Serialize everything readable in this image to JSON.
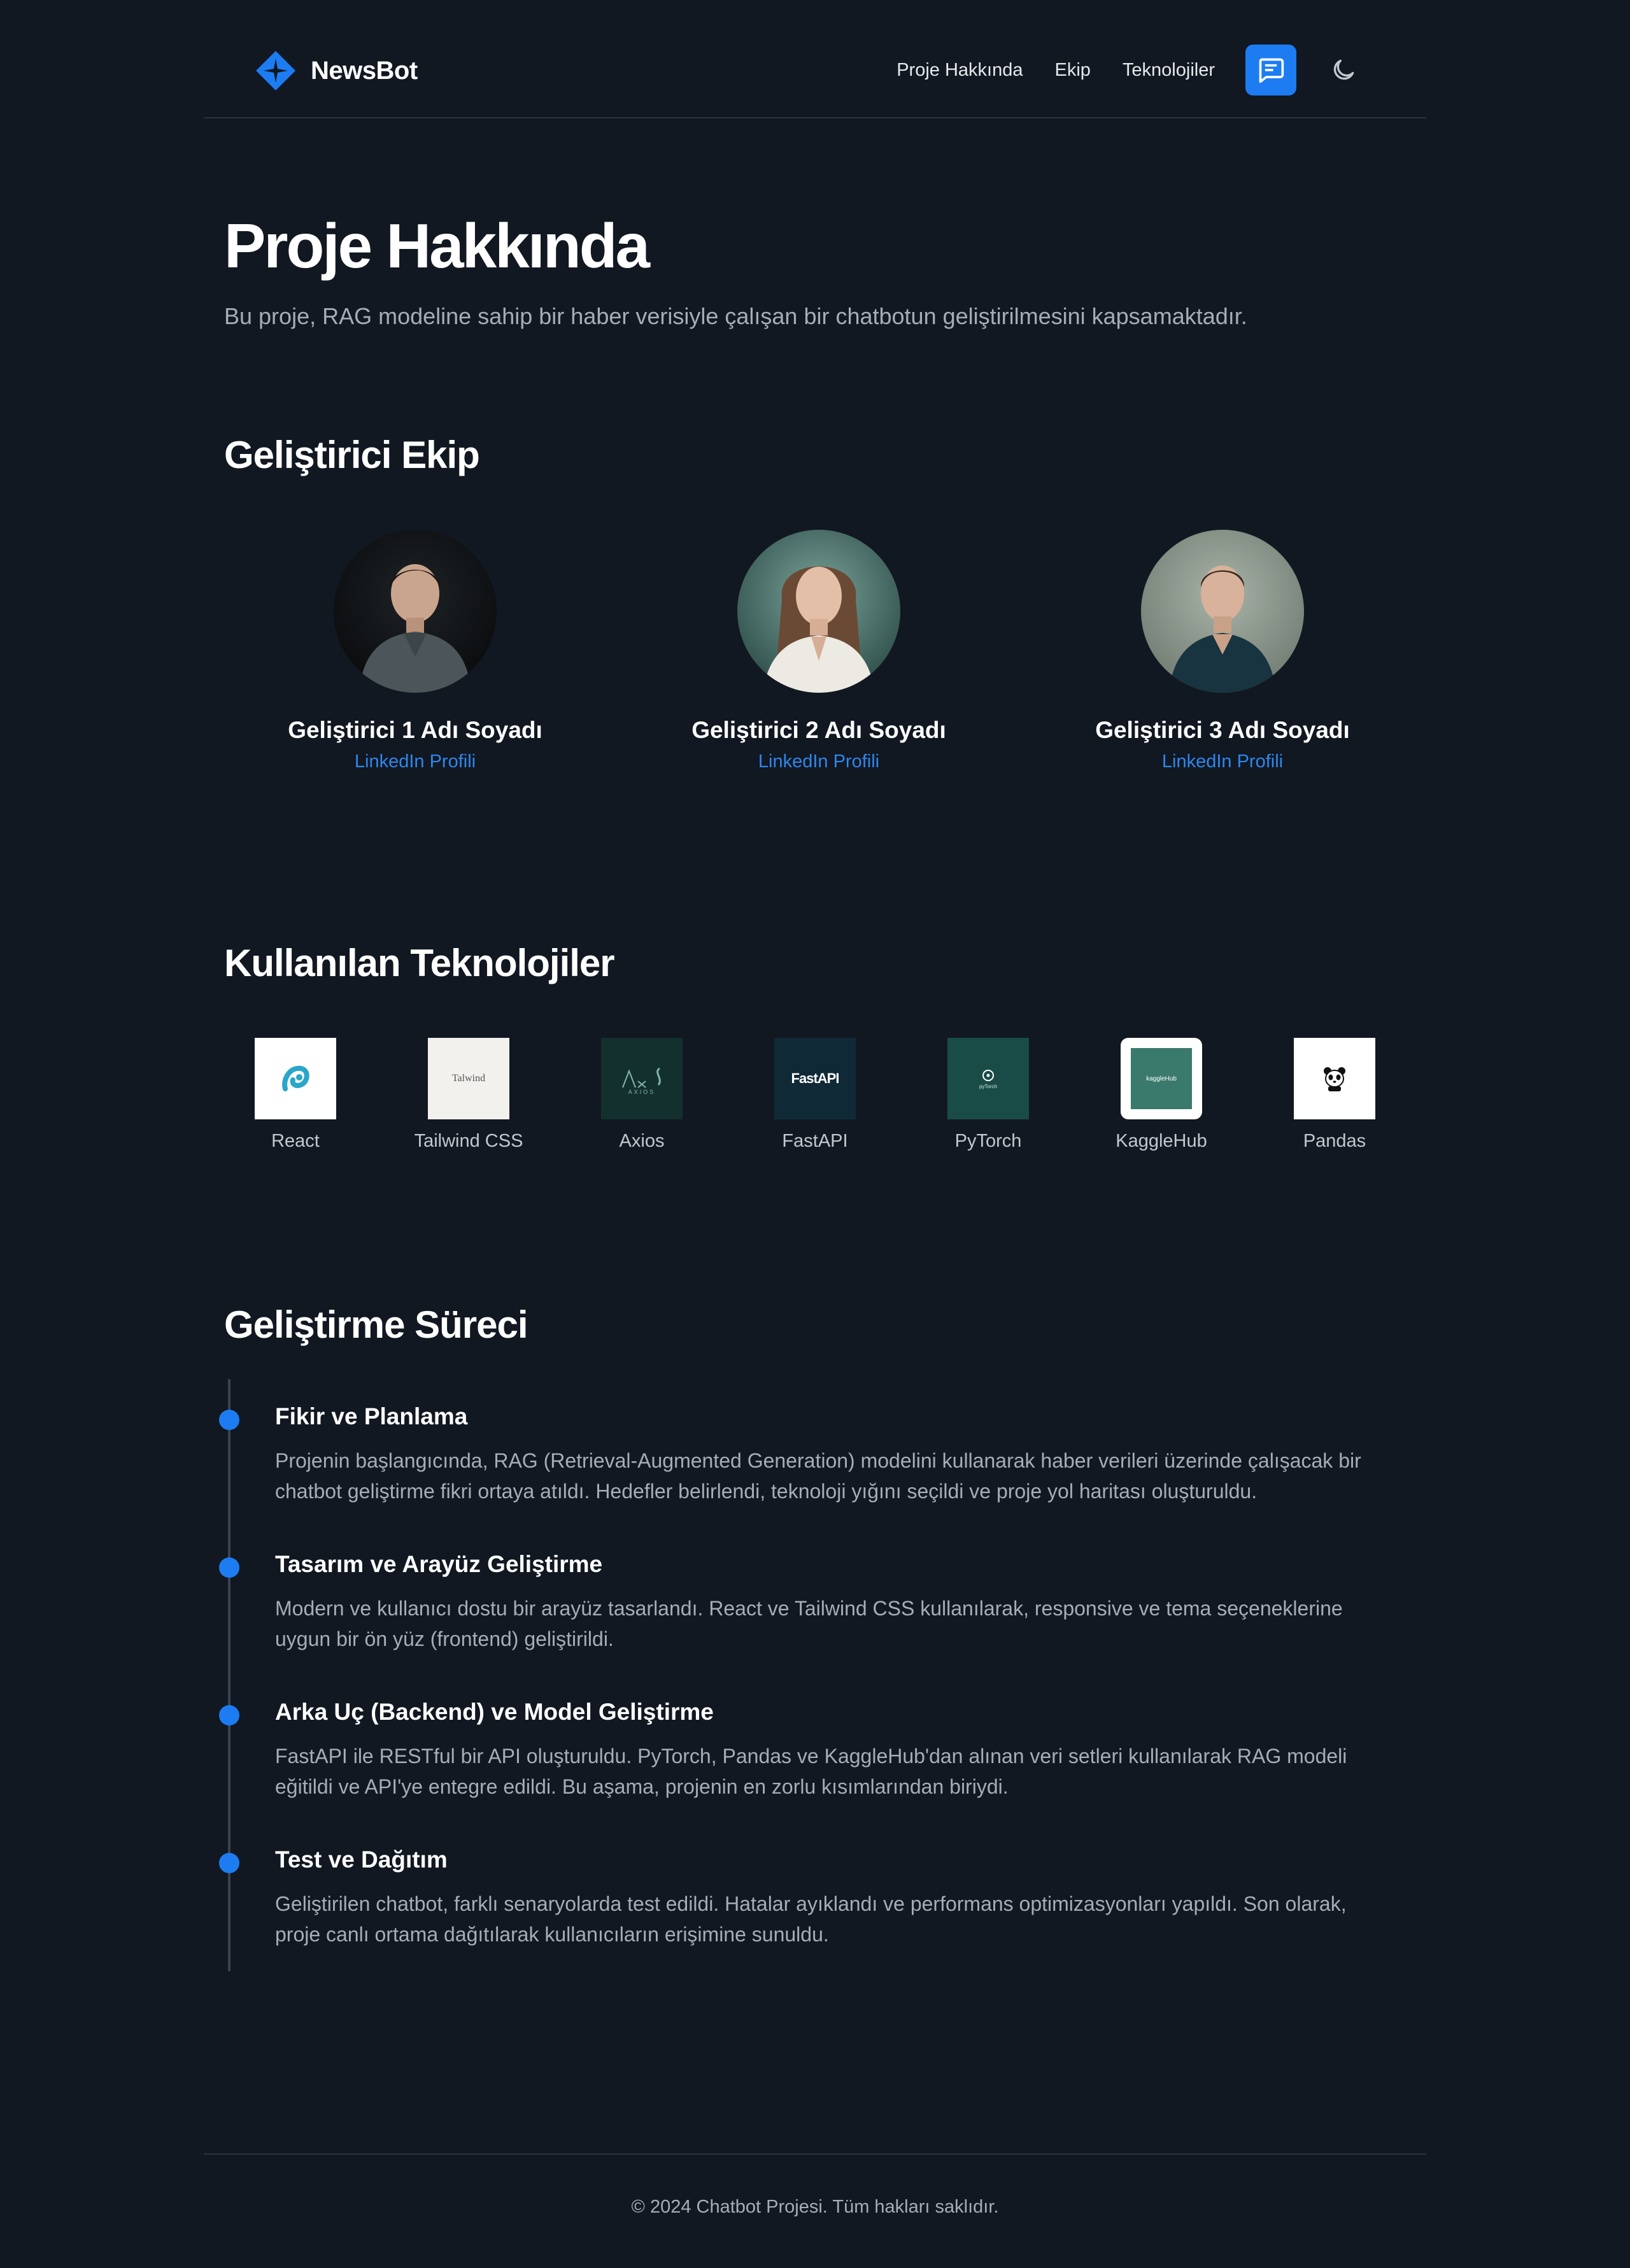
{
  "brand": {
    "name": "NewsBot",
    "accent": "#1d7cf2"
  },
  "nav": {
    "items": [
      {
        "label": "Proje Hakkında"
      },
      {
        "label": "Ekip"
      },
      {
        "label": "Teknolojiler"
      }
    ],
    "chat_icon": "chat-bubble-icon",
    "theme_icon": "moon-icon"
  },
  "hero": {
    "title": "Proje Hakkında",
    "subtitle": "Bu proje, RAG modeline sahip bir haber verisiyle çalışan bir chatbotun geliştirilmesini kapsamaktadır."
  },
  "team": {
    "heading": "Geliştirici Ekip",
    "members": [
      {
        "name": "Geliştirici 1 Adı Soyadı",
        "link": "LinkedIn Profili"
      },
      {
        "name": "Geliştirici 2 Adı Soyadı",
        "link": "LinkedIn Profili"
      },
      {
        "name": "Geliştirici 3 Adı Soyadı",
        "link": "LinkedIn Profili"
      }
    ]
  },
  "tech": {
    "heading": "Kullanılan Teknolojiler",
    "items": [
      {
        "label": "React",
        "icon": "react-logo"
      },
      {
        "label": "Tailwind CSS",
        "icon": "tailwind-logo",
        "logo_text": "Talwind"
      },
      {
        "label": "Axios",
        "icon": "axios-logo",
        "logo_text": "AXIOS"
      },
      {
        "label": "FastAPI",
        "icon": "fastapi-logo",
        "logo_text": "FastAPI"
      },
      {
        "label": "PyTorch",
        "icon": "pytorch-logo",
        "logo_text": "pyTorch"
      },
      {
        "label": "KaggleHub",
        "icon": "kagglehub-logo",
        "logo_text": "kaggleHub"
      },
      {
        "label": "Pandas",
        "icon": "pandas-logo"
      }
    ]
  },
  "process": {
    "heading": "Geliştirme Süreci",
    "steps": [
      {
        "title": "Fikir ve Planlama",
        "description": "Projenin başlangıcında, RAG (Retrieval-Augmented Generation) modelini kullanarak haber verileri üzerinde çalışacak bir chatbot geliştirme fikri ortaya atıldı. Hedefler belirlendi, teknoloji yığını seçildi ve proje yol haritası oluşturuldu."
      },
      {
        "title": "Tasarım ve Arayüz Geliştirme",
        "description": "Modern ve kullanıcı dostu bir arayüz tasarlandı. React ve Tailwind CSS kullanılarak, responsive ve tema seçeneklerine uygun bir ön yüz (frontend) geliştirildi."
      },
      {
        "title": "Arka Uç (Backend) ve Model Geliştirme",
        "description": "FastAPI ile RESTful bir API oluşturuldu. PyTorch, Pandas ve KaggleHub'dan alınan veri setleri kullanılarak RAG modeli eğitildi ve API'ye entegre edildi. Bu aşama, projenin en zorlu kısımlarından biriydi."
      },
      {
        "title": "Test ve Dağıtım",
        "description": "Geliştirilen chatbot, farklı senaryolarda test edildi. Hatalar ayıklandı ve performans optimizasyonları yapıldı. Son olarak, proje canlı ortama dağıtılarak kullanıcıların erişimine sunuldu."
      }
    ]
  },
  "footer": {
    "text": "© 2024 Chatbot Projesi. Tüm hakları saklıdır."
  }
}
